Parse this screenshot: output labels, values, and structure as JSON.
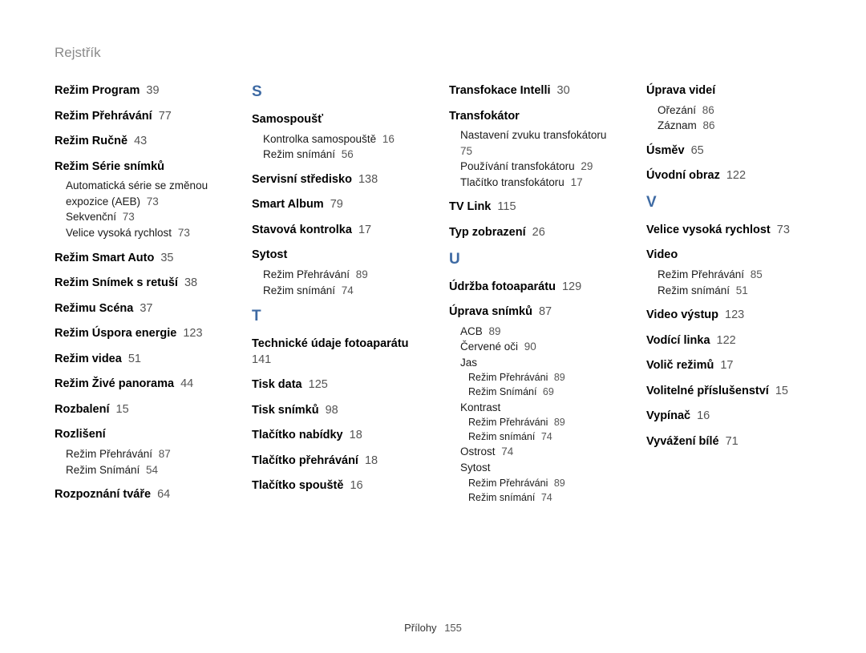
{
  "header": "Rejstřík",
  "footer_label": "Přílohy",
  "footer_page": "155",
  "columns": [
    {
      "items": [
        {
          "type": "entry",
          "title": "Režim Program",
          "page": "39"
        },
        {
          "type": "entry",
          "title": "Režim Přehrávání",
          "page": "77"
        },
        {
          "type": "entry",
          "title": "Režim Ručně",
          "page": "43"
        },
        {
          "type": "entry",
          "title": "Režim Série snímků",
          "subs": [
            {
              "text": "Automatická série se změnou expozice (AEB)",
              "page": "73"
            },
            {
              "text": "Sekvenční",
              "page": "73"
            },
            {
              "text": "Velice vysoká rychlost",
              "page": "73"
            }
          ]
        },
        {
          "type": "entry",
          "title": "Režim Smart Auto",
          "page": "35"
        },
        {
          "type": "entry",
          "title": "Režim Snímek s retuší",
          "page": "38"
        },
        {
          "type": "entry",
          "title": "Režimu Scéna",
          "page": "37"
        },
        {
          "type": "entry",
          "title": "Režim Úspora energie",
          "page": "123"
        },
        {
          "type": "entry",
          "title": "Režim videa",
          "page": "51"
        },
        {
          "type": "entry",
          "title": "Režim Živé panorama",
          "page": "44"
        },
        {
          "type": "entry",
          "title": "Rozbalení",
          "page": "15"
        },
        {
          "type": "entry",
          "title": "Rozlišení",
          "subs": [
            {
              "text": "Režim Přehrávání",
              "page": "87"
            },
            {
              "text": "Režim Snímání",
              "page": "54"
            }
          ]
        },
        {
          "type": "entry",
          "title": "Rozpoznání tváře",
          "page": "64"
        }
      ]
    },
    {
      "items": [
        {
          "type": "letter",
          "text": "S",
          "first": true
        },
        {
          "type": "entry",
          "title": "Samospoušť",
          "subs": [
            {
              "text": "Kontrolka samospouště",
              "page": "16"
            },
            {
              "text": "Režim snímání",
              "page": "56"
            }
          ]
        },
        {
          "type": "entry",
          "title": "Servisní středisko",
          "page": "138"
        },
        {
          "type": "entry",
          "title": "Smart Album",
          "page": "79"
        },
        {
          "type": "entry",
          "title": "Stavová kontrolka",
          "page": "17"
        },
        {
          "type": "entry",
          "title": "Sytost",
          "subs": [
            {
              "text": "Režim Přehrávání",
              "page": "89"
            },
            {
              "text": "Režim snímání",
              "page": "74"
            }
          ]
        },
        {
          "type": "letter",
          "text": "T"
        },
        {
          "type": "entry",
          "title": "Technické údaje fotoaparátu",
          "page": "141"
        },
        {
          "type": "entry",
          "title": "Tisk data",
          "page": "125"
        },
        {
          "type": "entry",
          "title": "Tisk snímků",
          "page": "98"
        },
        {
          "type": "entry",
          "title": "Tlačítko nabídky",
          "page": "18"
        },
        {
          "type": "entry",
          "title": "Tlačítko přehrávání",
          "page": "18"
        },
        {
          "type": "entry",
          "title": "Tlačítko spouště",
          "page": "16"
        }
      ]
    },
    {
      "items": [
        {
          "type": "entry",
          "title": "Transfokace Intelli",
          "page": "30"
        },
        {
          "type": "entry",
          "title": "Transfokátor",
          "subs": [
            {
              "text": "Nastavení zvuku transfokátoru",
              "page": "75"
            },
            {
              "text": "Používání transfokátoru",
              "page": "29"
            },
            {
              "text": "Tlačítko transfokátoru",
              "page": "17"
            }
          ]
        },
        {
          "type": "entry",
          "title": "TV Link",
          "page": "115"
        },
        {
          "type": "entry",
          "title": "Typ zobrazení",
          "page": "26"
        },
        {
          "type": "letter",
          "text": "U"
        },
        {
          "type": "entry",
          "title": "Údržba fotoaparátu",
          "page": "129"
        },
        {
          "type": "entry",
          "title": "Úprava snímků",
          "page": "87",
          "subs": [
            {
              "text": "ACB",
              "page": "89"
            },
            {
              "text": "Červené oči",
              "page": "90"
            },
            {
              "text": "Jas"
            },
            {
              "text": "Režim Přehráváni",
              "page": "89",
              "indent": true
            },
            {
              "text": "Režim Snímání",
              "page": "69",
              "indent": true
            },
            {
              "text": "Kontrast"
            },
            {
              "text": "Režim Přehráváni",
              "page": "89",
              "indent": true
            },
            {
              "text": "Režim snímání",
              "page": "74",
              "indent": true
            },
            {
              "text": "Ostrost",
              "page": "74"
            },
            {
              "text": "Sytost"
            },
            {
              "text": "Režim Přehráváni",
              "page": "89",
              "indent": true
            },
            {
              "text": "Režim snímání",
              "page": "74",
              "indent": true
            }
          ]
        }
      ]
    },
    {
      "items": [
        {
          "type": "entry",
          "title": "Úprava videí",
          "subs": [
            {
              "text": "Ořezání",
              "page": "86"
            },
            {
              "text": "Záznam",
              "page": "86"
            }
          ]
        },
        {
          "type": "entry",
          "title": "Úsměv",
          "page": "65"
        },
        {
          "type": "entry",
          "title": "Úvodní obraz",
          "page": "122"
        },
        {
          "type": "letter",
          "text": "V"
        },
        {
          "type": "entry",
          "title": "Velice vysoká rychlost",
          "page": "73"
        },
        {
          "type": "entry",
          "title": "Video",
          "subs": [
            {
              "text": "Režim Přehrávání",
              "page": "85"
            },
            {
              "text": "Režim snímání",
              "page": "51"
            }
          ]
        },
        {
          "type": "entry",
          "title": "Video výstup",
          "page": "123"
        },
        {
          "type": "entry",
          "title": "Vodící linka",
          "page": "122"
        },
        {
          "type": "entry",
          "title": "Volič režimů",
          "page": "17"
        },
        {
          "type": "entry",
          "title": "Volitelné příslušenství",
          "page": "15"
        },
        {
          "type": "entry",
          "title": "Vypínač",
          "page": "16"
        },
        {
          "type": "entry",
          "title": "Vyvážení bílé",
          "page": "71"
        }
      ]
    }
  ]
}
